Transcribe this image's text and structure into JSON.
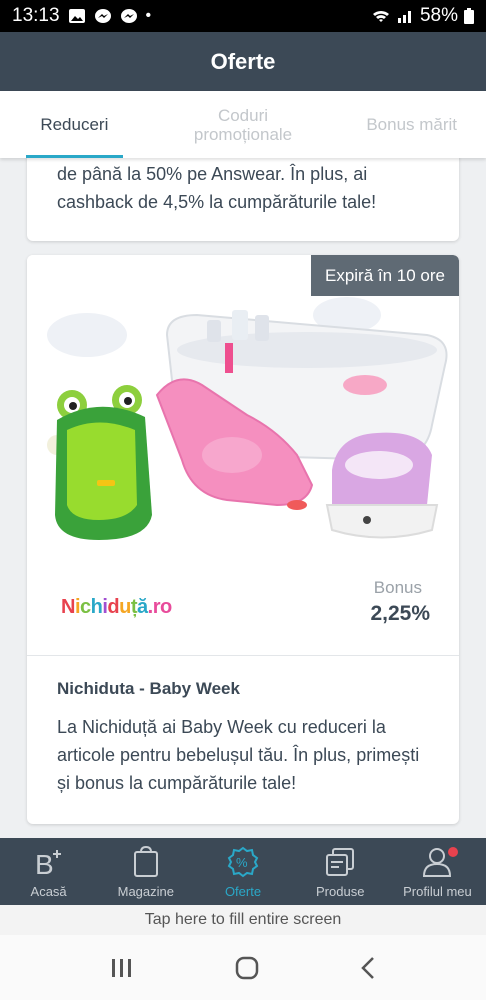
{
  "status": {
    "time": "13:13",
    "battery": "58%"
  },
  "header": {
    "title": "Oferte"
  },
  "tabs": [
    {
      "label": "Reduceri"
    },
    {
      "label": "Coduri promoționale"
    },
    {
      "label": "Bonus mărit"
    }
  ],
  "prev_card": {
    "text": "de până la 50% pe Answear. În plus, ai cashback de 4,5% la cumpărăturile tale!"
  },
  "offer": {
    "expires": "Expiră în 10 ore",
    "bonus_label": "Bonus",
    "bonus_value": "2,25%",
    "logo_text": "Nichiduță.ro",
    "title": "Nichiduta - Baby Week",
    "description": "La Nichiduță ai Baby Week cu reduceri la articole pentru bebelușul tău. În plus, primești și bonus la cumpărăturile tale!"
  },
  "bottom_nav": [
    {
      "label": "Acasă",
      "icon": "home-b-plus-icon"
    },
    {
      "label": "Magazine",
      "icon": "shopping-bag-icon"
    },
    {
      "label": "Oferte",
      "icon": "discount-badge-icon"
    },
    {
      "label": "Produse",
      "icon": "products-stack-icon"
    },
    {
      "label": "Profilul meu",
      "icon": "user-profile-icon"
    }
  ],
  "fill_screen": "Tap here to fill entire screen",
  "colors": {
    "header": "#3c4956",
    "accent": "#2aa8c8",
    "notification": "#e8424e"
  }
}
